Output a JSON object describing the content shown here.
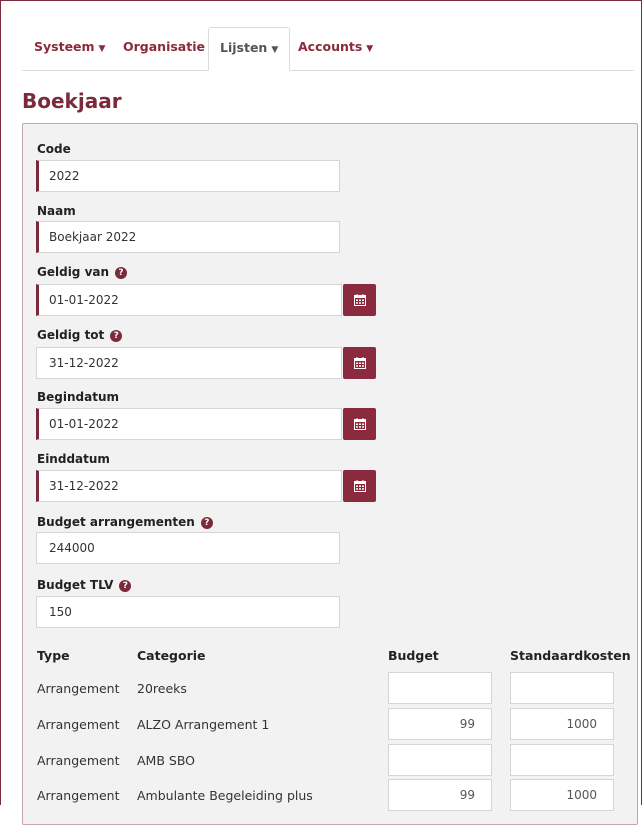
{
  "nav": {
    "tabs": [
      {
        "label": "Systeem",
        "caret": true
      },
      {
        "label": "Organisatie",
        "caret": false
      },
      {
        "label": "Lijsten",
        "caret": true
      },
      {
        "label": "Accounts",
        "caret": true
      }
    ],
    "active": "Lijsten"
  },
  "page": {
    "title": "Boekjaar"
  },
  "form": {
    "code": {
      "label": "Code",
      "value": "2022"
    },
    "naam": {
      "label": "Naam",
      "value": "Boekjaar 2022"
    },
    "geldig_van": {
      "label": "Geldig van",
      "value": "01-01-2022"
    },
    "geldig_tot": {
      "label": "Geldig tot",
      "value": "31-12-2022"
    },
    "begindatum": {
      "label": "Begindatum",
      "value": "01-01-2022"
    },
    "einddatum": {
      "label": "Einddatum",
      "value": "31-12-2022"
    },
    "budget_arr": {
      "label": "Budget arrangementen",
      "value": "244000"
    },
    "budget_tlv": {
      "label": "Budget TLV",
      "value": "150"
    }
  },
  "table": {
    "headers": {
      "type": "Type",
      "categorie": "Categorie",
      "budget": "Budget",
      "standaard": "Standaardkosten"
    },
    "rows": [
      {
        "type": "Arrangement",
        "categorie": "20reeks",
        "budget": "",
        "standaard": ""
      },
      {
        "type": "Arrangement",
        "categorie": "ALZO Arrangement 1",
        "budget": "99",
        "standaard": "1000"
      },
      {
        "type": "Arrangement",
        "categorie": "AMB SBO",
        "budget": "",
        "standaard": ""
      },
      {
        "type": "Arrangement",
        "categorie": "Ambulante Begeleiding plus",
        "budget": "99",
        "standaard": "1000"
      }
    ]
  },
  "colors": {
    "accent": "#8b2a3e"
  },
  "icons": {
    "help": "question-circle-icon",
    "calendar": "calendar-icon",
    "caret": "caret-down-icon"
  }
}
